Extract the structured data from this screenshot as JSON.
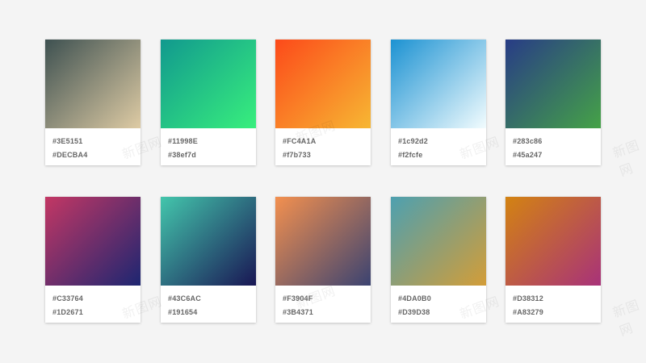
{
  "palettes": [
    {
      "from": "#3E5151",
      "to": "#DECBA4",
      "label_from": "#3E5151",
      "label_to": "#DECBA4"
    },
    {
      "from": "#11998E",
      "to": "#38ef7d",
      "label_from": "#11998E",
      "label_to": "#38ef7d"
    },
    {
      "from": "#FC4A1A",
      "to": "#f7b733",
      "label_from": "#FC4A1A",
      "label_to": "#f7b733"
    },
    {
      "from": "#1c92d2",
      "to": "#f2fcfe",
      "label_from": "#1c92d2",
      "label_to": "#f2fcfe"
    },
    {
      "from": "#283c86",
      "to": "#45a247",
      "label_from": "#283c86",
      "label_to": "#45a247"
    },
    {
      "from": "#C33764",
      "to": "#1D2671",
      "label_from": "#C33764",
      "label_to": "#1D2671"
    },
    {
      "from": "#43C6AC",
      "to": "#191654",
      "label_from": "#43C6AC",
      "label_to": "#191654"
    },
    {
      "from": "#F3904F",
      "to": "#3B4371",
      "label_from": "#F3904F",
      "label_to": "#3B4371"
    },
    {
      "from": "#4DA0B0",
      "to": "#D39D38",
      "label_from": "#4DA0B0",
      "label_to": "#D39D38"
    },
    {
      "from": "#D38312",
      "to": "#A83279",
      "label_from": "#D38312",
      "label_to": "#A83279"
    }
  ],
  "watermark": "新图网"
}
